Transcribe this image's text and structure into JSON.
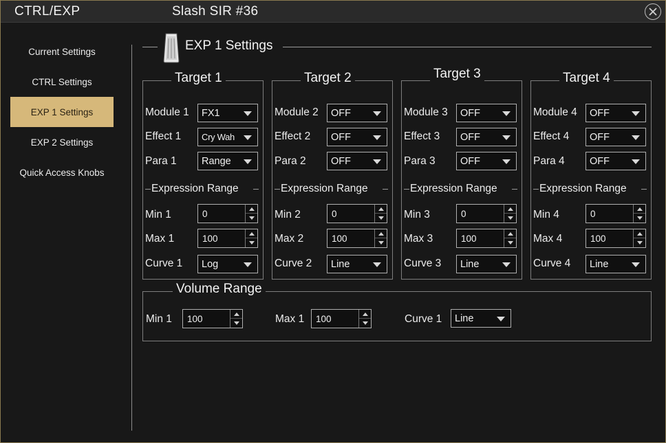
{
  "window": {
    "app_title": "CTRL/EXP",
    "preset_title": "Slash SIR #36"
  },
  "sidebar": {
    "items": [
      {
        "label": "Current Settings"
      },
      {
        "label": "CTRL Settings"
      },
      {
        "label": "EXP 1 Settings",
        "active": true
      },
      {
        "label": "EXP 2 Settings"
      },
      {
        "label": "Quick Access Knobs"
      }
    ]
  },
  "section": {
    "title": "EXP 1 Settings"
  },
  "targets": [
    {
      "title": "Target 1",
      "module_label": "Module 1",
      "module_value": "FX1",
      "effect_label": "Effect 1",
      "effect_value": "Cry Wah",
      "para_label": "Para 1",
      "para_value": "Range",
      "range_title": "Expression Range",
      "min_label": "Min 1",
      "min_value": "0",
      "max_label": "Max 1",
      "max_value": "100",
      "curve_label": "Curve 1",
      "curve_value": "Log"
    },
    {
      "title": "Target 2",
      "module_label": "Module 2",
      "module_value": "OFF",
      "effect_label": "Effect 2",
      "effect_value": "OFF",
      "para_label": "Para 2",
      "para_value": "OFF",
      "range_title": "Expression Range",
      "min_label": "Min 2",
      "min_value": "0",
      "max_label": "Max 2",
      "max_value": "100",
      "curve_label": "Curve 2",
      "curve_value": "Line"
    },
    {
      "title": "Target 3",
      "module_label": "Module 3",
      "module_value": "OFF",
      "effect_label": "Effect 3",
      "effect_value": "OFF",
      "para_label": "Para 3",
      "para_value": "OFF",
      "range_title": "Expression Range",
      "min_label": "Min 3",
      "min_value": "0",
      "max_label": "Max 3",
      "max_value": "100",
      "curve_label": "Curve 3",
      "curve_value": "Line"
    },
    {
      "title": "Target 4",
      "module_label": "Module 4",
      "module_value": "OFF",
      "effect_label": "Effect 4",
      "effect_value": "OFF",
      "para_label": "Para 4",
      "para_value": "OFF",
      "range_title": "Expression Range",
      "min_label": "Min 4",
      "min_value": "0",
      "max_label": "Max 4",
      "max_value": "100",
      "curve_label": "Curve 4",
      "curve_value": "Line"
    }
  ],
  "volume": {
    "title": "Volume Range",
    "min_label": "Min 1",
    "min_value": "100",
    "max_label": "Max 1",
    "max_value": "100",
    "curve_label": "Curve 1",
    "curve_value": "Line"
  },
  "icons": {
    "close": "close-icon",
    "pedal": "expression-pedal-icon",
    "caret": "chevron-down-icon",
    "spin_up": "arrow-up-icon",
    "spin_down": "arrow-down-icon"
  },
  "colors": {
    "accent": "#d6b87a",
    "background": "#181818",
    "border": "#7e7e7e"
  }
}
